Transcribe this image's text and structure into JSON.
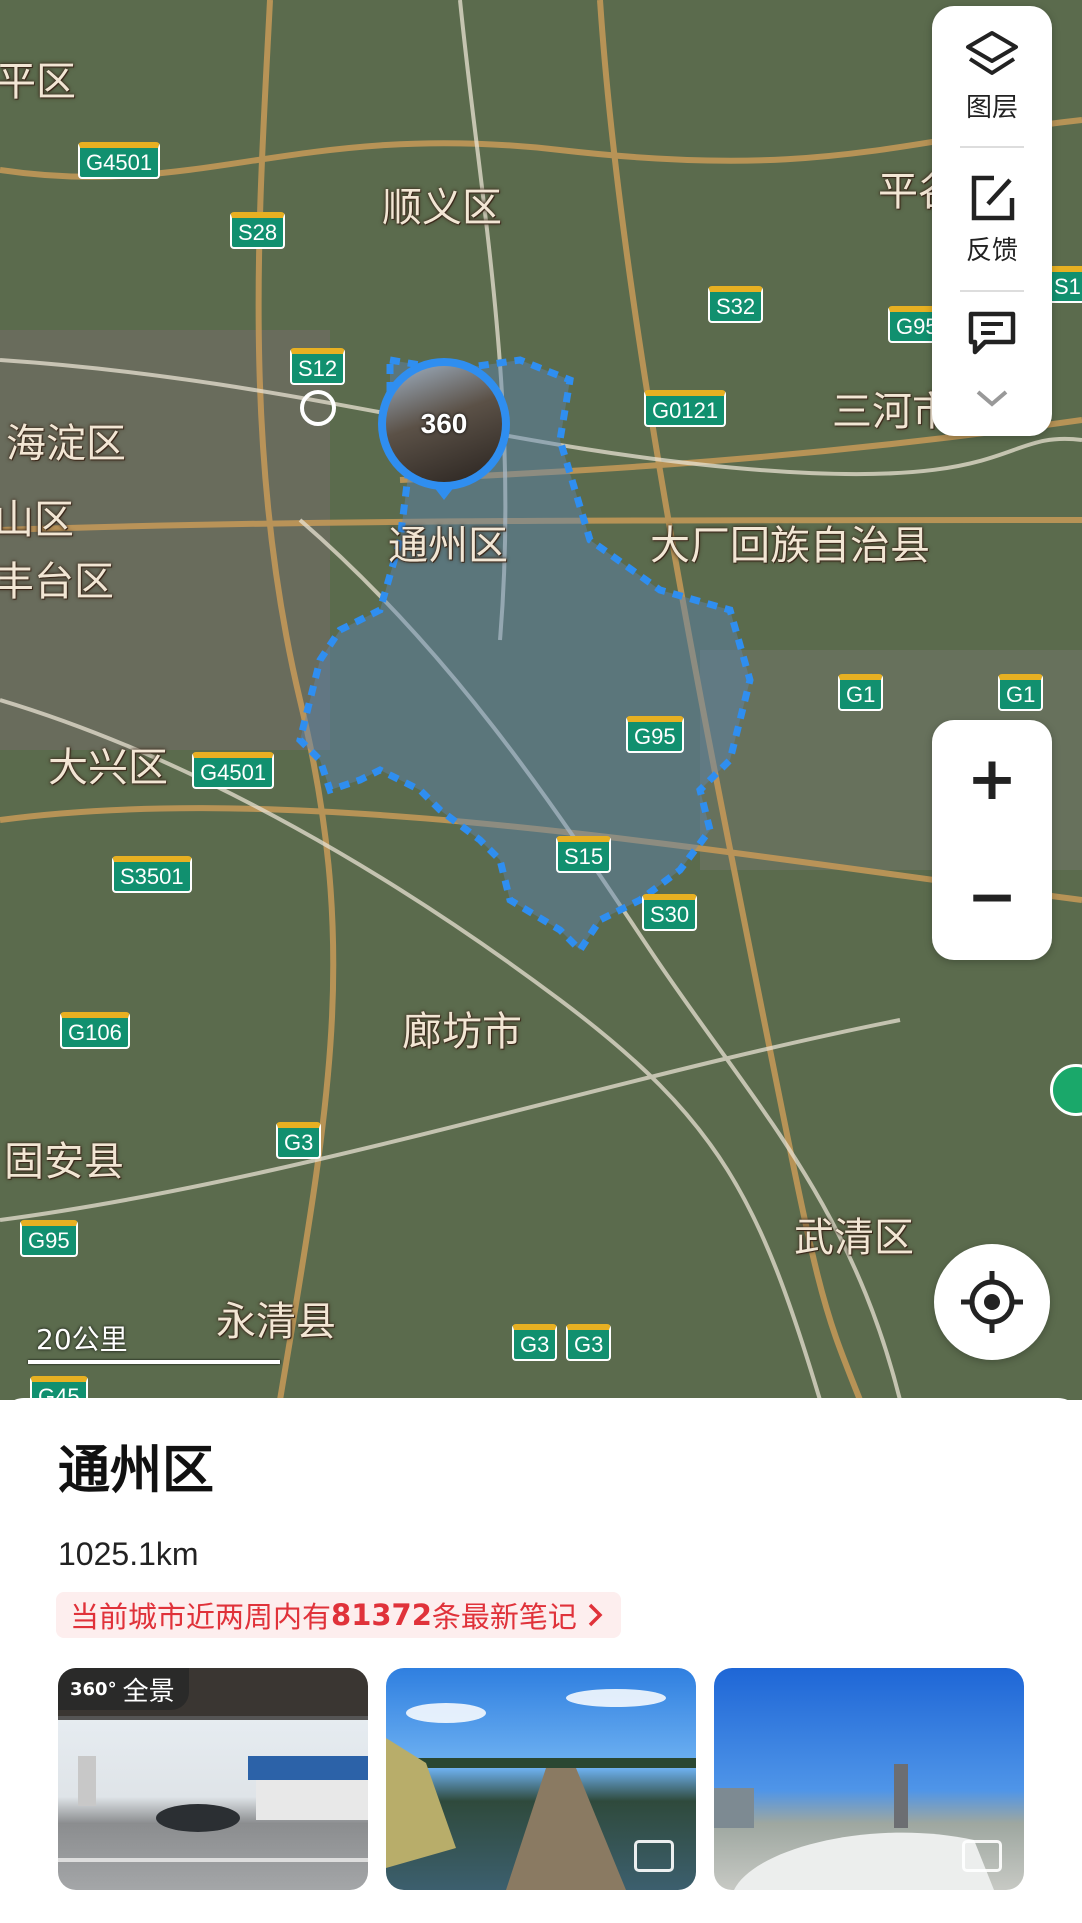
{
  "map": {
    "places": [
      "平区",
      "顺义区",
      "平谷",
      "三河市",
      "海淀区",
      "山区",
      "丰台区",
      "通州区",
      "大厂回族自治县",
      "大兴区",
      "廊坊市",
      "固安县",
      "武清区",
      "永清县"
    ],
    "shields": [
      "G4501",
      "S28",
      "S32",
      "G95",
      "S12",
      "G0121",
      "S1",
      "G1",
      "G1",
      "G95",
      "G4501",
      "S3501",
      "S15",
      "S30",
      "G106",
      "G3",
      "G95",
      "G3",
      "G3",
      "G45"
    ],
    "panorama_label": "360",
    "scale_label": "20公里"
  },
  "controls": {
    "layers_label": "图层",
    "feedback_label": "反馈",
    "zoom_in": "+",
    "zoom_out": "−"
  },
  "panel": {
    "title": "通州区",
    "distance": "1025.1km",
    "notes_prefix": "当前城市近两周内有",
    "notes_count": "81372",
    "notes_suffix": "条最新笔记",
    "thumb_badge_icon": "360°",
    "thumb_badge_label": "全景"
  },
  "colors": {
    "boundary": "#2f8ef0",
    "shield_green": "#11906f",
    "notes_red": "#e0323a"
  }
}
